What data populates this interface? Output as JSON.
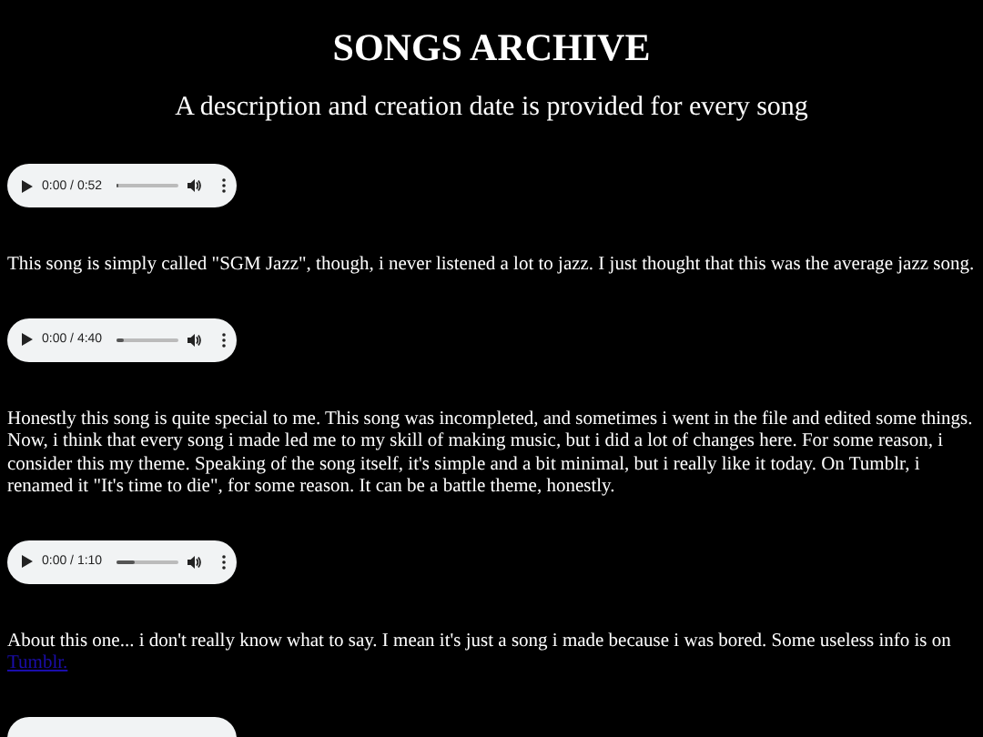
{
  "header": {
    "title": "SONGS ARCHIVE",
    "subtitle": "A description and creation date is provided for every song"
  },
  "songs": [
    {
      "player": {
        "time": "0:00 / 0:52",
        "level": 0.03
      },
      "description": "This song is simply called \"SGM Jazz\", though, i never listened a lot to jazz. I just thought that this was the average jazz song."
    },
    {
      "player": {
        "time": "0:00 / 4:40",
        "level": 0.12
      },
      "description": "Honestly this song is quite special to me. This song was incompleted, and sometimes i went in the file and edited some things. Now, i think that every song i made led me to my skill of making music, but i did a lot of changes here. For some reason, i consider this my theme. Speaking of the song itself, it's simple and a bit minimal, but i really like it today. On Tumblr, i renamed it \"It's time to die\", for some reason. It can be a battle theme, honestly."
    },
    {
      "player": {
        "time": "0:00 / 1:10",
        "level": 0.3
      },
      "description": "About this one... i don't really know what to say. I mean it's just a song i made because i was bored. Some useless info is on",
      "link": "Tumblr."
    },
    {
      "kind": "cut_off_player"
    }
  ]
}
